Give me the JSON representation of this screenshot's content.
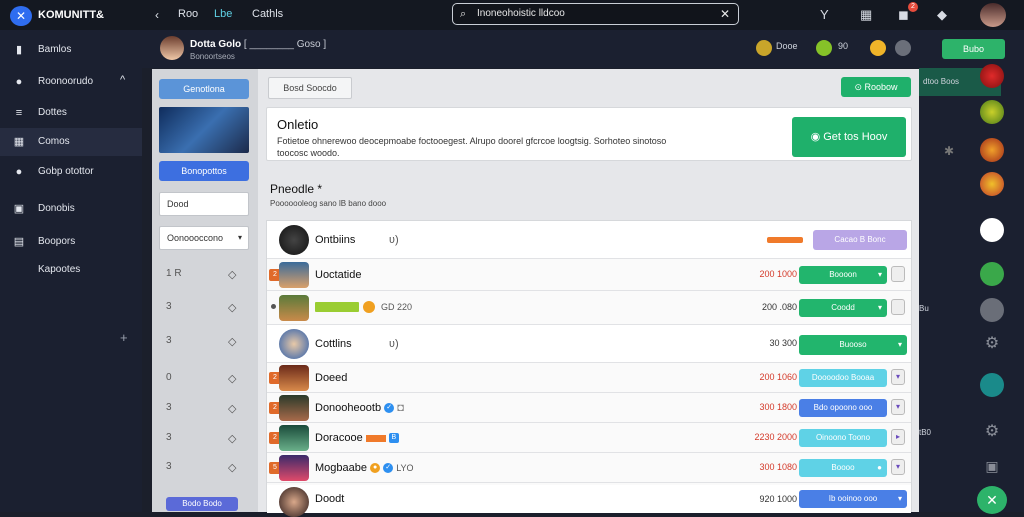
{
  "topbar": {
    "brand": "KOMUNITT&",
    "back_icon": "‹",
    "nav": [
      "Roo",
      "Lbe",
      "Cathls"
    ],
    "search_value": "Inoneohoistic  lldcoo",
    "icons": [
      "filter-icon",
      "grid-icon",
      "notification-icon",
      "bell-icon"
    ],
    "notification_count": "2"
  },
  "sidebar": {
    "items": [
      {
        "label": "Bamlos",
        "icon": "▮"
      },
      {
        "label": "Roonoorudo",
        "icon": "●",
        "chevron": "^"
      },
      {
        "label": "Dottes",
        "icon": "≡"
      },
      {
        "label": "Comos",
        "icon": "▦"
      },
      {
        "label": "Gobp otottor",
        "icon": "●"
      },
      {
        "label": "Donobis",
        "icon": "▣"
      },
      {
        "label": "Boopors",
        "icon": "▤"
      },
      {
        "label": "Kapootes",
        "icon": ""
      }
    ],
    "add": "+"
  },
  "header": {
    "title": "Dotta Golo",
    "title_extra": "[ ________ Goso ]",
    "subtitle": "Bonoortseos",
    "stat1": "Dooe",
    "stat2": "90",
    "join_label": "Bubo"
  },
  "left_panel": {
    "primary": "Genotlona",
    "action": "Bonopottos",
    "input1": "Dood",
    "select": "Oonoooccono",
    "rows": [
      {
        "a": "1 R",
        "b": "◇"
      },
      {
        "a": "3",
        "b": "◇"
      },
      {
        "a": "3",
        "b": "◇"
      },
      {
        "a": "0",
        "b": "◇"
      },
      {
        "a": "3",
        "b": "◇"
      },
      {
        "a": "3",
        "b": "◇"
      },
      {
        "a": "3",
        "b": "◇"
      }
    ],
    "bottom_btn": "Bodo Bodo"
  },
  "main": {
    "chip": "Bosd Soocdo",
    "rec_btn": "Roobow",
    "card_title": "Onletio",
    "card_desc": "Fotietoe ohnerewoo deocepmoabe foctooegest. Alrupo doorel gfcrcoe loogtsig. Sorhoteo sinotoso toocosc woodo.",
    "get_btn": "Get tos Hoov",
    "section_title": "Pneodle *",
    "section_sub": "Pooooooleog sano  lB  bano dooo"
  },
  "list": [
    {
      "type": "group",
      "name": "Ontbiins",
      "sub": "ʋ)",
      "pts": "",
      "btn": "Cacao B Bonc",
      "btn_color": "#b9a6e6",
      "rank_bar": true
    },
    {
      "type": "player",
      "rank": "2",
      "name": "Uoctatide",
      "sub": "",
      "pts": "200 1000",
      "btn": "Boooon",
      "btn_color": "#22b56d",
      "side": ""
    },
    {
      "type": "player",
      "rank": "",
      "name": "",
      "sub": "GD 220",
      "pts": "200 .080",
      "btn": "Coodd",
      "btn_color": "#22b56d",
      "side": ""
    },
    {
      "type": "group",
      "name": "Cottlins",
      "sub": "ʋ)",
      "pts": "30 300",
      "btn": "Buooso",
      "btn_color": "#22b56d"
    },
    {
      "type": "player",
      "rank": "2",
      "name": "Doeed",
      "sub": "",
      "pts": "200 1060",
      "btn": "Doooodoo Booaa",
      "btn_color": "#5fd2e6",
      "side": "▾"
    },
    {
      "type": "player",
      "rank": "2",
      "name": "Donooheootb",
      "sub": "",
      "pts": "300 1800",
      "btn": "Bdo opoono ooo",
      "btn_color": "#4a7fe6",
      "side": "▾"
    },
    {
      "type": "player",
      "rank": "2",
      "name": "Doracooe",
      "sub": "",
      "pts": "2230 2000",
      "btn": "Oinoono Toono",
      "btn_color": "#5fd2e6",
      "side": "▸"
    },
    {
      "type": "player",
      "rank": "5",
      "name": "Mogbaabe",
      "sub": "LYO",
      "pts": "300 1080",
      "btn": "Boooo",
      "btn_color": "#5fd2e6",
      "side": "▾"
    },
    {
      "type": "group",
      "name": "Doodt",
      "sub": "",
      "pts": "920 1000",
      "btn": "Ib ooinoo ooo",
      "btn_color": "#4a7fe6"
    }
  ],
  "rail": {
    "texts": [
      "dtoo Boos",
      "Bu",
      "tB0"
    ]
  }
}
